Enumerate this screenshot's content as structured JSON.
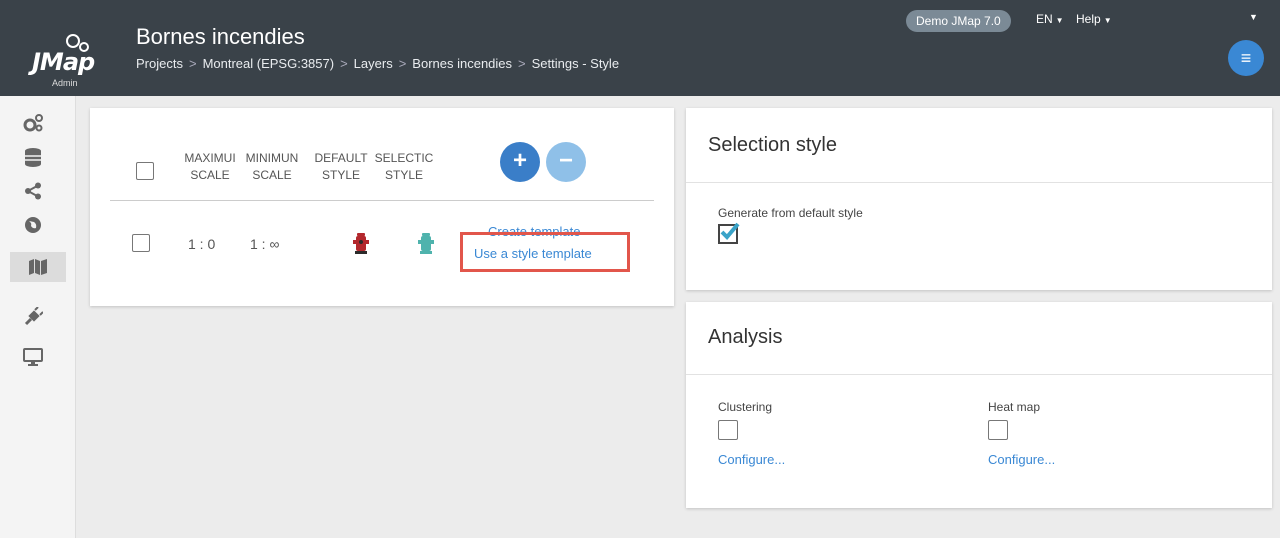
{
  "app": {
    "logo_text": "JMap",
    "logo_sub": "Admin",
    "page_title": "Bornes incendies",
    "breadcrumb": [
      "Projects",
      "Montreal (EPSG:3857)",
      "Layers",
      "Bornes incendies",
      "Settings - Style"
    ],
    "demo_badge": "Demo JMap 7.0",
    "lang_menu": "EN",
    "help_menu": "Help"
  },
  "sidebar": {
    "items": [
      {
        "icon": "gears-icon"
      },
      {
        "icon": "database-icon"
      },
      {
        "icon": "share-icon"
      },
      {
        "icon": "globe-icon"
      },
      {
        "icon": "map-icon",
        "active": true
      },
      {
        "icon": "plug-icon"
      },
      {
        "icon": "monitor-icon"
      }
    ]
  },
  "styles_table": {
    "headers": {
      "max": [
        "MAXIMUI",
        "SCALE"
      ],
      "min": [
        "MINIMUN",
        "SCALE"
      ],
      "default": [
        "DEFAULT",
        "STYLE"
      ],
      "selection": [
        "SELECTIC",
        "STYLE"
      ]
    },
    "row": {
      "max_scale": "1 : 0",
      "min_scale": "1 : ∞",
      "create_template": "Create template",
      "use_template": "Use a style template"
    },
    "add_label": "+",
    "remove_label": "−"
  },
  "selection_style": {
    "title": "Selection style",
    "generate_label": "Generate from default style",
    "generate_checked": true
  },
  "analysis": {
    "title": "Analysis",
    "clustering_label": "Clustering",
    "clustering_configure": "Configure...",
    "heatmap_label": "Heat map",
    "heatmap_configure": "Configure..."
  },
  "colors": {
    "topbar": "#3a4249",
    "accent": "#3a88d4",
    "highlight": "#e2564b",
    "hydrant_default": "#b3282d",
    "hydrant_selection": "#4fb3ad"
  }
}
